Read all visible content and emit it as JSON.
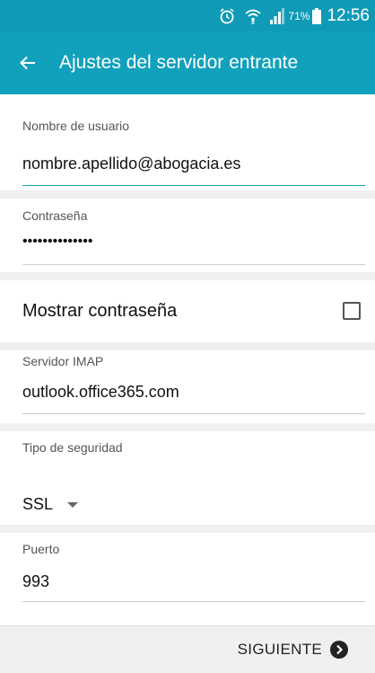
{
  "status_bar": {
    "battery": "71%",
    "time": "12:56",
    "icons": [
      "alarm-icon",
      "wifi-icon",
      "signal-icon",
      "battery-icon"
    ]
  },
  "app_bar": {
    "title": "Ajustes del servidor entrante",
    "back_icon": "arrow-back-icon"
  },
  "form": {
    "username": {
      "label": "Nombre de usuario",
      "value": "nombre.apellido@abogacia.es"
    },
    "password": {
      "label": "Contraseña",
      "value": "••••••••••••••"
    },
    "show_password": {
      "label": "Mostrar contraseña",
      "checked": false
    },
    "imap_server": {
      "label": "Servidor IMAP",
      "value": "outlook.office365.com"
    },
    "security_type": {
      "label": "Tipo de seguridad",
      "value": "SSL"
    },
    "port": {
      "label": "Puerto",
      "value": "993"
    }
  },
  "bottom_bar": {
    "next_label": "SIGUIENTE",
    "next_icon": "chevron-right-circle-icon"
  },
  "colors": {
    "accent": "#12a1bc",
    "status_bar": "#0f9bb7"
  }
}
